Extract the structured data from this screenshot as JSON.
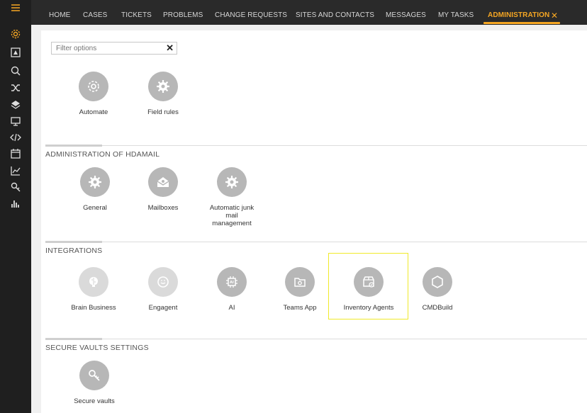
{
  "nav": {
    "tabs": [
      {
        "label": "HOME"
      },
      {
        "label": "CASES"
      },
      {
        "label": "TICKETS"
      },
      {
        "label": "PROBLEMS"
      },
      {
        "label": "CHANGE REQUESTS"
      },
      {
        "label": "SITES AND CONTACTS"
      },
      {
        "label": "MESSAGES"
      },
      {
        "label": "MY TASKS"
      },
      {
        "label": "ADMINISTRATION"
      }
    ],
    "active_tab": "ADMINISTRATION",
    "close_glyph": "✕"
  },
  "rail": {
    "icons": [
      "menu-icon",
      "settings-icon",
      "alert-icon",
      "search-help-icon",
      "shuffle-icon",
      "layers-icon",
      "monitor-icon",
      "code-icon",
      "calendar-icon",
      "chart-icon",
      "key-search-icon",
      "bar-chart-icon"
    ],
    "active_icon": "settings-icon"
  },
  "filter": {
    "placeholder": "Filter options",
    "clear_glyph": "✕"
  },
  "general": {
    "tiles": [
      {
        "label": "Automate",
        "icon": "gear-cycle-icon"
      },
      {
        "label": "Field rules",
        "icon": "gear-icon"
      }
    ]
  },
  "hdamail": {
    "title": "ADMINISTRATION OF HDAMAIL",
    "tiles": [
      {
        "label": "General",
        "icon": "gear-icon"
      },
      {
        "label": "Mailboxes",
        "icon": "mailbox-icon"
      },
      {
        "label": "Automatic junk mail management",
        "icon": "gear-icon"
      }
    ]
  },
  "integrations": {
    "title": "INTEGRATIONS",
    "tiles": [
      {
        "label": "Brain Business",
        "icon": "brain-icon"
      },
      {
        "label": "Engagent",
        "icon": "chat-icon"
      },
      {
        "label": "AI",
        "icon": "ai-chip-icon"
      },
      {
        "label": "Teams App",
        "icon": "folder-gear-icon"
      },
      {
        "label": "Inventory Agents",
        "icon": "inventory-box-icon"
      },
      {
        "label": "CMDBuild",
        "icon": "hexagon-icon"
      }
    ]
  },
  "vaults": {
    "title": "SECURE VAULTS SETTINGS",
    "tiles": [
      {
        "label": "Secure vaults",
        "icon": "key-icon"
      }
    ]
  },
  "colors": {
    "accent": "#f5a623",
    "rail_bg": "#1f1f1f",
    "topbar_bg": "#2a2a2a",
    "tile_circle": "#b7b7b7",
    "highlight": "#f0ea2a"
  }
}
